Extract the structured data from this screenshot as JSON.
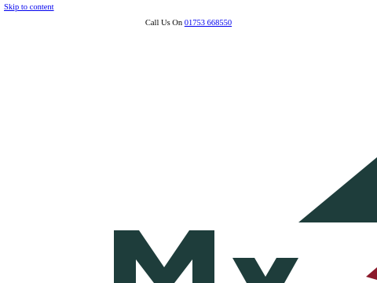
{
  "skip_link": "Skip to content",
  "topbar": {
    "call_prefix": "Call Us On",
    "phone": "01753 668550"
  },
  "logo": {
    "icon": "brand-logo-icon",
    "colors": {
      "primary": "#1e3d3b",
      "accent": "#8b1a2b"
    }
  }
}
